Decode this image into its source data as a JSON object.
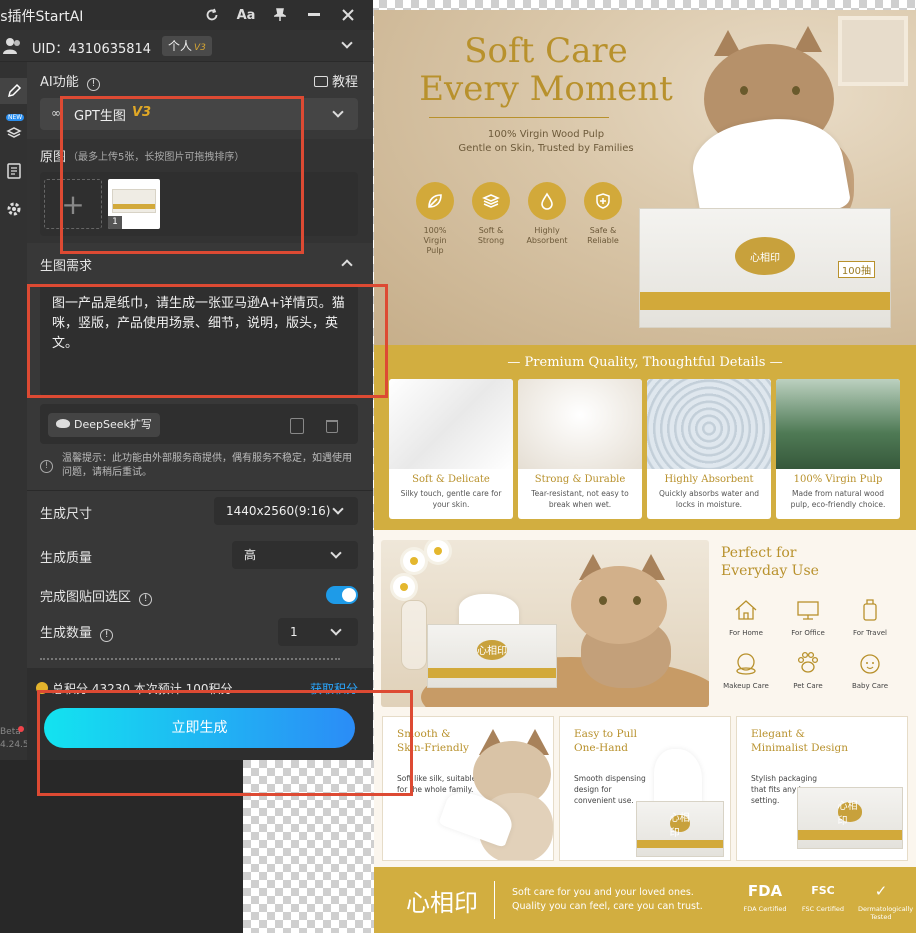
{
  "plugin": {
    "title": "Ps插件StartAI",
    "titlebar_icons": [
      "refresh-icon",
      "text-size-icon",
      "pin-icon",
      "minimize-icon",
      "close-icon"
    ],
    "text_size_label": "Aa",
    "uid_label": "UID：4310635814",
    "account_type": "个人",
    "account_level": "V3",
    "ai_function_label": "AI功能",
    "tutorial_label": "教程",
    "model_name": "GPT生图",
    "model_version": "V3",
    "source_label": "原图",
    "source_hint": "（最多上传5张，长按图片可拖拽排序）",
    "thumb_index": "1",
    "request_label": "生图需求",
    "prompt_text": "图一产品是纸巾，请生成一张亚马逊A+详情页。猫咪，竖版，产品使用场景、细节，说明，版头，英文。",
    "deepseek_label": "DeepSeek扩写",
    "warning_text": "温馨提示：此功能由外部服务商提供，偶有服务不稳定，如遇使用问题，请稍后重试。",
    "size_label": "生成尺寸",
    "size_value": "1440x2560(9:16)",
    "quality_label": "生成质量",
    "quality_value": "高",
    "paste_back_label": "完成图贴回选区",
    "paste_back_on": true,
    "count_label": "生成数量",
    "count_value": "1",
    "points_text": "总积分 43230  本次预计 100积分",
    "points_link": "获取积分",
    "generate_label": "立即生成",
    "beta_label": "Beta",
    "version_label": "4.24.5",
    "new_tag": "NEW",
    "accent_color": "#2aa7ff",
    "highlight_color": "#dd4a33"
  },
  "poster": {
    "hero_title_line1": "Soft Care",
    "hero_title_line2": "Every Moment",
    "hero_sub_line1": "100% Virgin Wood Pulp",
    "hero_sub_line2": "Gentle on Skin, Trusted by Families",
    "badges": [
      {
        "line1": "100%",
        "line2": "Virgin Pulp",
        "icon": "leaf-icon"
      },
      {
        "line1": "Soft &",
        "line2": "Strong",
        "icon": "layers-icon"
      },
      {
        "line1": "Highly",
        "line2": "Absorbent",
        "icon": "droplet-icon"
      },
      {
        "line1": "Safe &",
        "line2": "Reliable",
        "icon": "shield-plus-icon"
      }
    ],
    "box_brand": "心相印",
    "box_count": "100抽",
    "quality_title": "— Premium Quality, Thoughtful Details —",
    "quality_cards": [
      {
        "title": "Soft & Delicate",
        "desc": "Silky touch, gentle care for your skin."
      },
      {
        "title": "Strong & Durable",
        "desc": "Tear-resistant, not easy to break when wet."
      },
      {
        "title": "Highly Absorbent",
        "desc": "Quickly absorbs water and locks in moisture."
      },
      {
        "title": "100% Virgin Pulp",
        "desc": "Made from natural wood pulp, eco-friendly choice."
      }
    ],
    "everyday_title_line1": "Perfect for",
    "everyday_title_line2": "Everyday Use",
    "uses": [
      {
        "label": "For Home",
        "icon": "home-icon"
      },
      {
        "label": "For Office",
        "icon": "monitor-icon"
      },
      {
        "label": "For Travel",
        "icon": "luggage-icon"
      },
      {
        "label": "Makeup Care",
        "icon": "compact-mirror-icon"
      },
      {
        "label": "Pet Care",
        "icon": "paw-icon"
      },
      {
        "label": "Baby Care",
        "icon": "baby-face-icon"
      }
    ],
    "panels": [
      {
        "title_line1": "Smooth &",
        "title_line2": "Skin-Friendly",
        "desc": "Soft like silk, suitable for the whole family."
      },
      {
        "title_line1": "Easy to Pull",
        "title_line2": "One-Hand",
        "desc": "Smooth dispensing design for convenient use."
      },
      {
        "title_line1": "Elegant &",
        "title_line2": "Minimalist Design",
        "desc": "Stylish packaging that fits any home setting."
      }
    ],
    "footer_logo": "心相印",
    "footer_line1": "Soft care for you and your loved ones.",
    "footer_line2": "Quality you can feel, care you can trust.",
    "certs": [
      {
        "mark": "FDA",
        "label": "FDA Certified"
      },
      {
        "mark": "FSC",
        "label": "FSC Certified"
      },
      {
        "mark": "✓",
        "label": "Dermatologically Tested"
      }
    ],
    "gold_color": "#d2ae40"
  }
}
